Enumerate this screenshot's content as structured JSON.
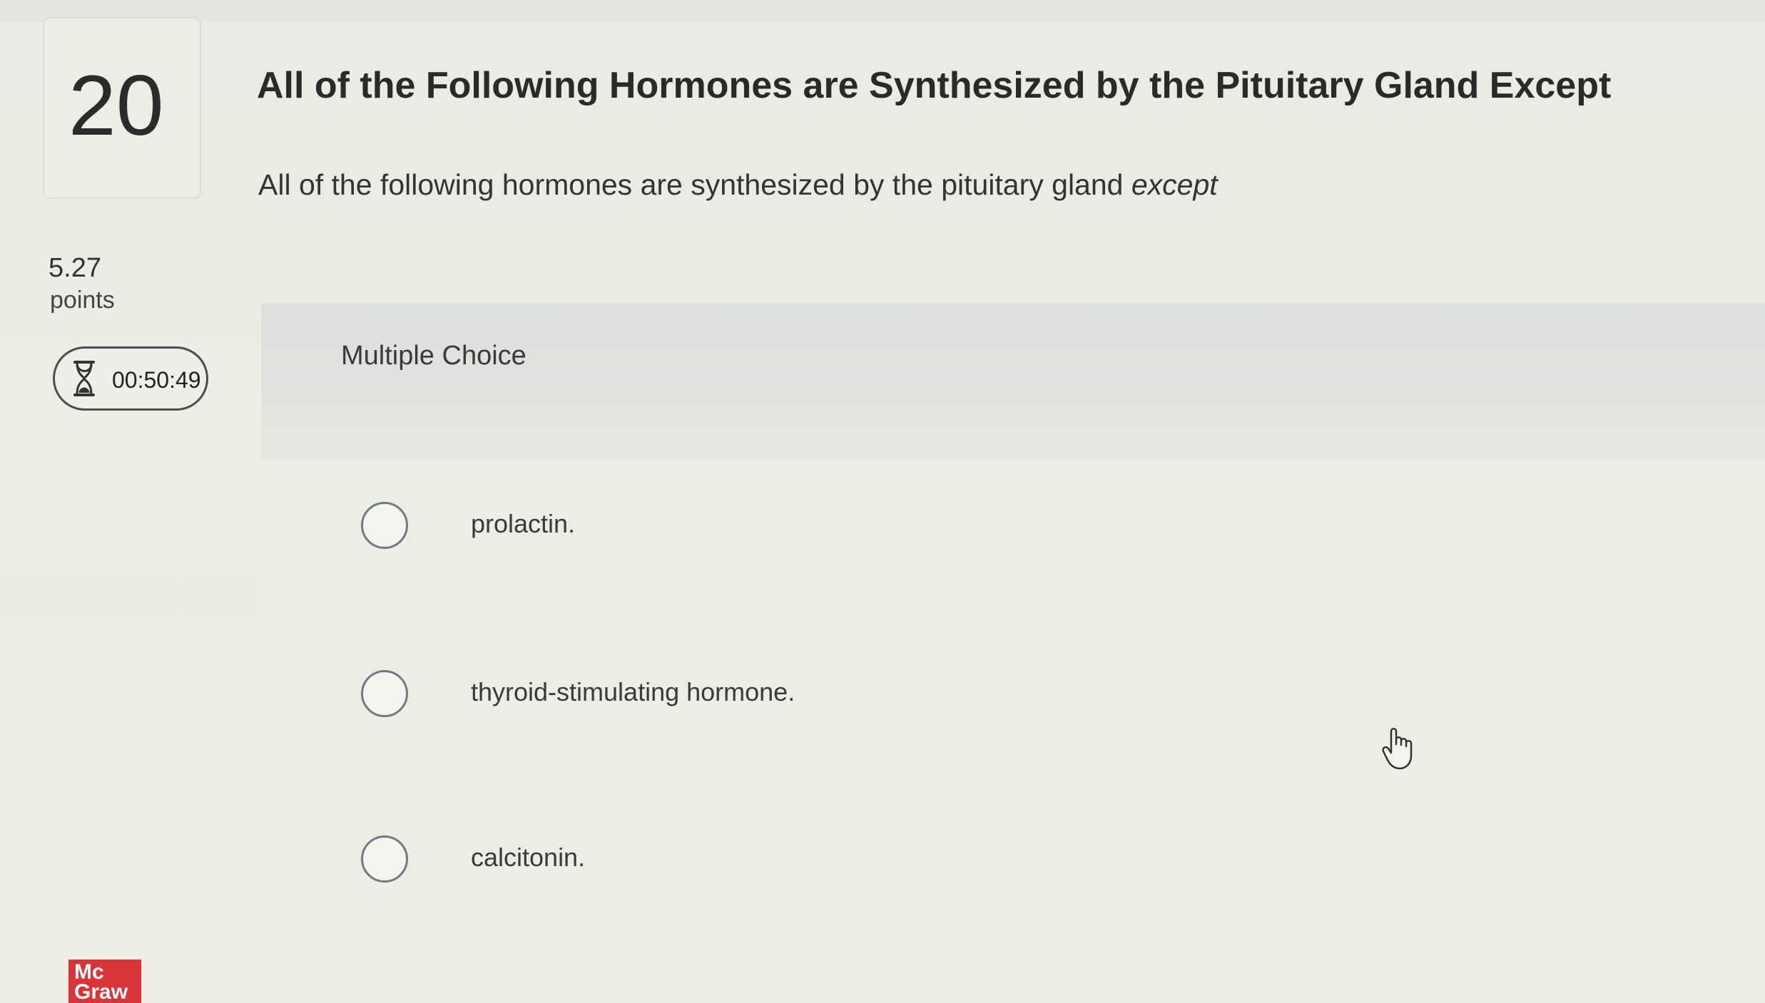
{
  "question": {
    "number": "20",
    "points_value": "5.27",
    "points_label": "points",
    "timer": "00:50:49",
    "title": "All of the Following Hormones are Synthesized by the Pituitary Gland Except",
    "prompt_main": "All of the following hormones are synthesized by the pituitary gland ",
    "prompt_emphasis": "except"
  },
  "answer_section": {
    "type_label": "Multiple Choice",
    "options": [
      {
        "label": "prolactin."
      },
      {
        "label": "thyroid-stimulating hormone."
      },
      {
        "label": "calcitonin."
      }
    ]
  },
  "logo": {
    "line1": "Mc",
    "line2": "Graw"
  },
  "icons": {
    "timer": "hourglass-icon",
    "cursor": "hand-cursor-icon"
  }
}
